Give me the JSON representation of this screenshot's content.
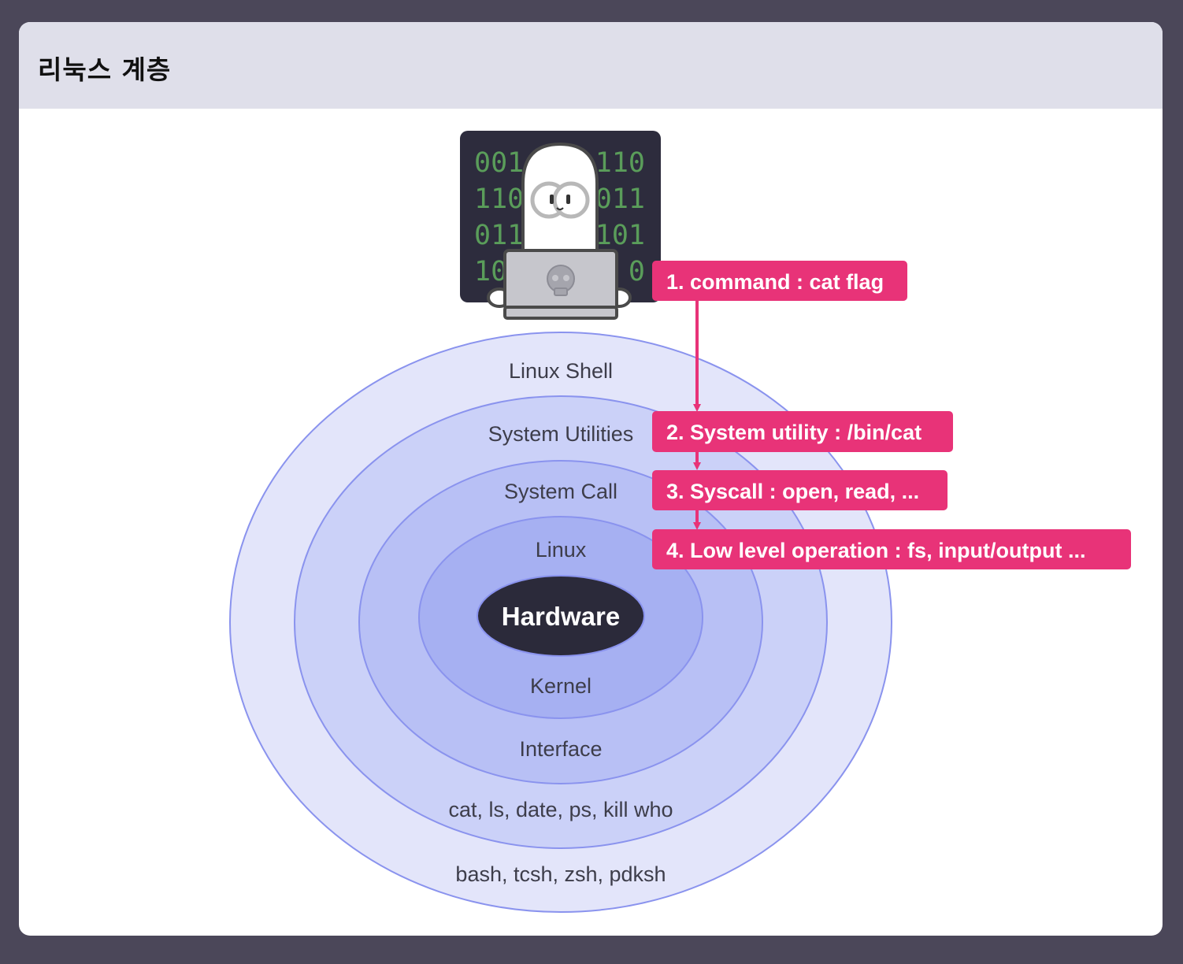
{
  "header": {
    "title": "리눅스 계층"
  },
  "terminal": {
    "binary_rows": [
      [
        "001",
        "110"
      ],
      [
        "110",
        "011"
      ],
      [
        "011",
        "101"
      ],
      [
        "10",
        "0"
      ]
    ]
  },
  "layers": {
    "shell": {
      "name": "Linux Shell",
      "examples": "bash, tcsh, zsh, pdksh"
    },
    "utilities": {
      "name": "System Utilities",
      "examples": "cat, ls, date, ps, kill who"
    },
    "syscall": {
      "name": "System Call",
      "examples": "Interface"
    },
    "kernel": {
      "name": "Linux",
      "examples": "Kernel"
    },
    "core": {
      "name": "Hardware"
    }
  },
  "steps": [
    {
      "label": "1. command : cat flag"
    },
    {
      "label": "2. System utility : /bin/cat"
    },
    {
      "label": "3. Syscall : open, read, ..."
    },
    {
      "label": "4. Low level operation : fs, input/output ..."
    }
  ],
  "colors": {
    "accent": "#e83378",
    "layer_outer": "#e3e5fa",
    "layer_2": "#cbd1f8",
    "layer_3": "#b8c0f5",
    "layer_4": "#a6b0f2",
    "core": "#2b2a3a",
    "ring_stroke": "#8a93ee"
  }
}
